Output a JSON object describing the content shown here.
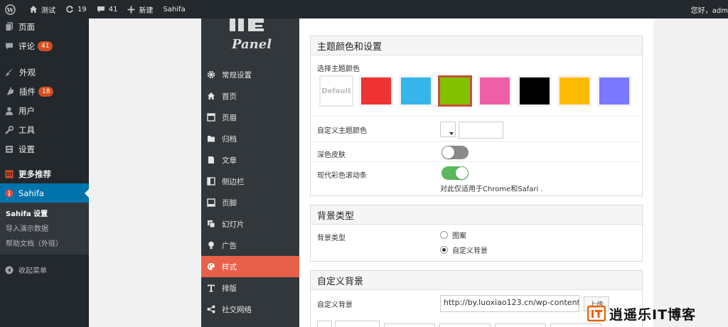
{
  "adminbar": {
    "site_name": "测试",
    "updates_count": "19",
    "comments_count": "41",
    "new_label": "新建",
    "plugin_label": "Sahifa",
    "greeting": "您好，adm"
  },
  "admin_menu": {
    "items": [
      {
        "label": "页面"
      },
      {
        "label": "评论",
        "badge": "41"
      },
      {
        "label": "外观"
      },
      {
        "label": "插件",
        "badge": "18"
      },
      {
        "label": "用户"
      },
      {
        "label": "工具"
      },
      {
        "label": "设置"
      },
      {
        "label": "更多推荐"
      },
      {
        "label": "Sahifa"
      }
    ],
    "submenu": [
      "Sahifa 设置",
      "导入演示数据",
      "帮助文档（外链）"
    ],
    "collapse_label": "收起菜单"
  },
  "panel": {
    "logo_text": "Panel",
    "nav": [
      {
        "label": "常规设置",
        "icon": "gear-icon"
      },
      {
        "label": "首页",
        "icon": "home-icon"
      },
      {
        "label": "页眉",
        "icon": "header-icon"
      },
      {
        "label": "归档",
        "icon": "folder-icon"
      },
      {
        "label": "文章",
        "icon": "document-icon"
      },
      {
        "label": "侧边栏",
        "icon": "sidebar-icon"
      },
      {
        "label": "页脚",
        "icon": "footer-icon"
      },
      {
        "label": "幻灯片",
        "icon": "slides-icon"
      },
      {
        "label": "广告",
        "icon": "lightbulb-icon"
      },
      {
        "label": "样式",
        "icon": "palette-icon"
      },
      {
        "label": "排版",
        "icon": "typography-icon"
      },
      {
        "label": "社交网络",
        "icon": "share-icon"
      }
    ]
  },
  "theme_colors": {
    "title": "主题颜色和设置",
    "choose_label": "选择主题颜色",
    "default_label": "Default",
    "swatches": [
      "#ee3333",
      "#36b5ea",
      "#81c100",
      "#ef5fa7",
      "#000000",
      "#ffbb01",
      "#7b78ff"
    ],
    "custom_color_label": "自定义主题颜色",
    "dark_skin_label": "深色皮肤",
    "scrollbar_label": "现代彩色滚动条",
    "scrollbar_note": "对此仅适用于Chrome和Safari ."
  },
  "background_type": {
    "title": "背景类型",
    "label": "背景类型",
    "option_pattern": "图案",
    "option_custom": "自定义背景"
  },
  "custom_background": {
    "title": "自定义背景",
    "label": "自定义背景",
    "url_value": "http://by.luoxiao123.cn/wp-content/",
    "upload_label": "上传"
  },
  "watermark": {
    "text": "逍遥乐IT博客"
  }
}
